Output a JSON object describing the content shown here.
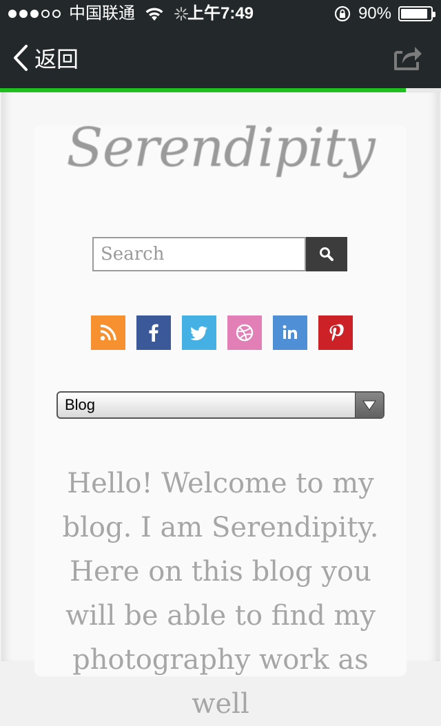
{
  "status_bar": {
    "carrier": "中国联通",
    "time": "上午7:49",
    "battery_percent": "90%",
    "battery_level": 0.9,
    "signal_bars_filled": 3,
    "signal_bars_total": 5
  },
  "nav_bar": {
    "back_label": "返回",
    "page_load_progress": 0.92
  },
  "page": {
    "logo_text": "Serendipity",
    "search": {
      "placeholder": "Search",
      "value": ""
    },
    "social_links": [
      {
        "name": "rss",
        "icon": "rss-icon",
        "color": "#f7902e"
      },
      {
        "name": "facebook",
        "icon": "facebook-icon",
        "color": "#3b5998"
      },
      {
        "name": "twitter",
        "icon": "twitter-icon",
        "color": "#45b0e3"
      },
      {
        "name": "dribbble",
        "icon": "dribbble-icon",
        "color": "#e27fb7"
      },
      {
        "name": "linkedin",
        "icon": "linkedin-icon",
        "color": "#4f8fd6"
      },
      {
        "name": "pinterest",
        "icon": "pinterest-icon",
        "color": "#cc2127"
      }
    ],
    "nav_select": {
      "selected": "Blog"
    },
    "intro": "Hello! Welcome to my blog. I am Serendipity. Here on this blog you will be able to find my photography work as well"
  },
  "colors": {
    "status_bar_bg": "#23282b",
    "progress": "#1ec01e",
    "text_gray": "#a6a6a6"
  }
}
